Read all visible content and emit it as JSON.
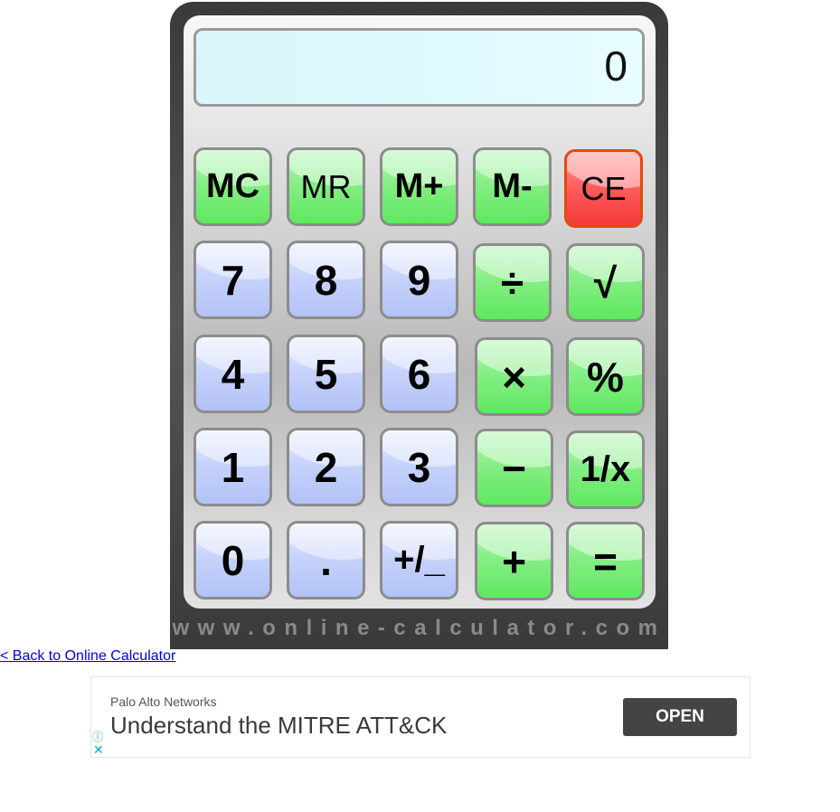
{
  "display": {
    "value": "0"
  },
  "keys": {
    "mc": "MC",
    "mr": "MR",
    "mplus": "M+",
    "mminus": "M-",
    "ce": "CE",
    "k7": "7",
    "k8": "8",
    "k9": "9",
    "divide": "÷",
    "sqrt": "√",
    "k4": "4",
    "k5": "5",
    "k6": "6",
    "multiply": "×",
    "percent": "%",
    "k1": "1",
    "k2": "2",
    "k3": "3",
    "minus": "−",
    "reciprocal": "1/x",
    "k0": "0",
    "dot": ".",
    "plusminus": "+/_",
    "plus": "+",
    "equals": "="
  },
  "footer": {
    "site": "www.online-calculator.com"
  },
  "back_link": {
    "label": "< Back to Online Calculator"
  },
  "ad": {
    "brand": "Palo Alto Networks",
    "headline": "Understand the MITRE ATT&CK",
    "button": "OPEN",
    "info_icon": "ⓘ",
    "close_icon": "✕"
  },
  "colors": {
    "operator_key": "#86ee86",
    "digit_key": "#c7d3fb",
    "clear_key": "#ff5757",
    "display_bg": "#dffaff"
  }
}
